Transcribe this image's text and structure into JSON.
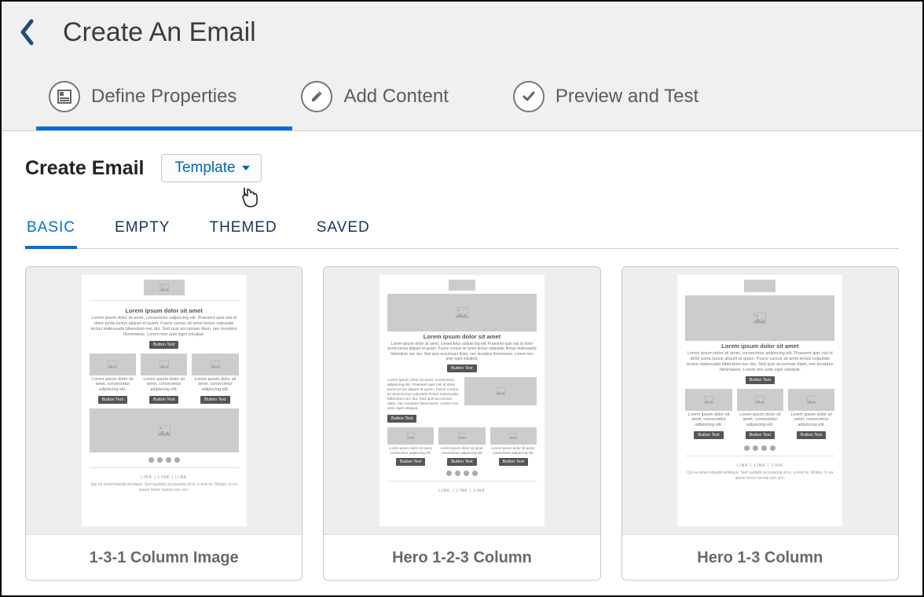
{
  "header": {
    "title": "Create An Email"
  },
  "steps": [
    {
      "label": "Define Properties",
      "icon": "properties-icon",
      "active": true
    },
    {
      "label": "Add Content",
      "icon": "edit-icon",
      "active": false
    },
    {
      "label": "Preview and Test",
      "icon": "check-icon",
      "active": false
    }
  ],
  "section": {
    "title": "Create Email",
    "dropdown_label": "Template"
  },
  "tabs": [
    {
      "label": "BASIC",
      "active": true
    },
    {
      "label": "EMPTY",
      "active": false
    },
    {
      "label": "THEMED",
      "active": false
    },
    {
      "label": "SAVED",
      "active": false
    }
  ],
  "templates": [
    {
      "name": "1-3-1 Column Image"
    },
    {
      "name": "Hero 1-2-3 Column"
    },
    {
      "name": "Hero 1-3 Column"
    }
  ],
  "mock": {
    "heading": "Lorem ipsum dolor sit amet",
    "paragraph": "Lorem ipsum dolor sit amet, consectetur adipiscing elit. Praesent quis nisi id dolor porta luctus aliquet et quam. Fusce cursus sit amet lectus vulputate lectus malesuada bibendum nec dui. Sed quis accumsan diam, nec inceptos himenaeos. Lorem non ante eget volutpat.",
    "small_heading": "Lorem ipsum dolor sit amet, consectetur adipiscing elit.",
    "button": "Button Text",
    "links": "LINK  |  LINK  |  LINK",
    "footnote": "Qui ea amet impedit similique. Sed laudatis accusantia sit in, a erat mi. Molips. In ea ipsum lorem lacinia non orci."
  }
}
